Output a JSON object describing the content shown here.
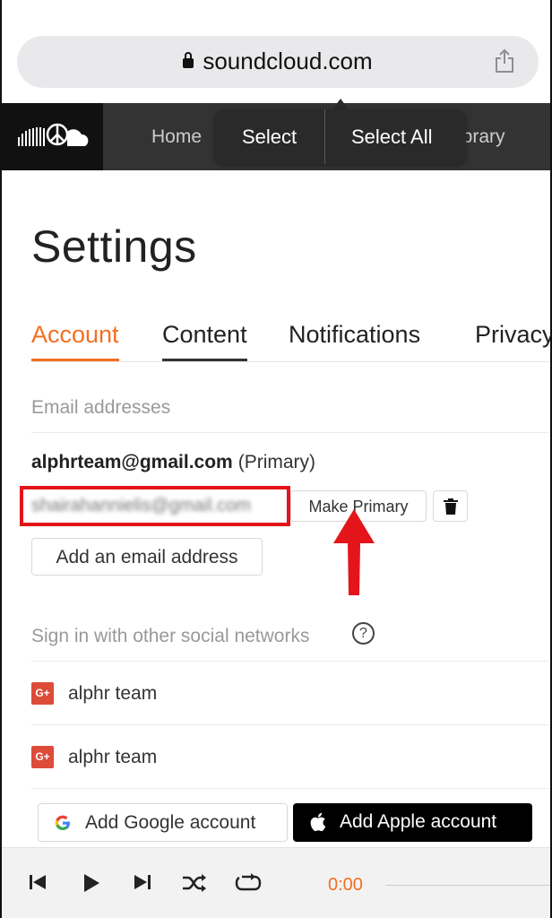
{
  "browser": {
    "url": "soundcloud.com",
    "icons": {
      "lock": "lock-icon",
      "share": "share-icon"
    }
  },
  "header": {
    "nav_home": "Home",
    "nav_library_partial": "ibrary"
  },
  "context_menu": {
    "select": "Select",
    "select_all": "Select All"
  },
  "page": {
    "title": "Settings",
    "tabs": [
      {
        "label": "Account",
        "active": true
      },
      {
        "label": "Content",
        "active": false
      },
      {
        "label": "Notifications",
        "active": false
      },
      {
        "label": "Privacy",
        "active": false
      }
    ]
  },
  "emails": {
    "section_label": "Email addresses",
    "primary_email": "alphrteam@gmail.com",
    "primary_tag": "(Primary)",
    "secondary_email": "shairahannielis@gmail.com",
    "make_primary_label": "Make Primary",
    "add_email_label": "Add an email address"
  },
  "social": {
    "section_label": "Sign in with other social networks",
    "help_label": "?",
    "accounts": [
      {
        "provider": "G+",
        "name": "alphr team"
      },
      {
        "provider": "G+",
        "name": "alphr team"
      }
    ],
    "add_google_label": "Add Google account",
    "add_apple_label": "Add Apple account"
  },
  "player": {
    "time": "0:00"
  },
  "colors": {
    "accent": "#f26f23",
    "annotation_red": "#e3151a",
    "nav_bg": "#333333"
  }
}
